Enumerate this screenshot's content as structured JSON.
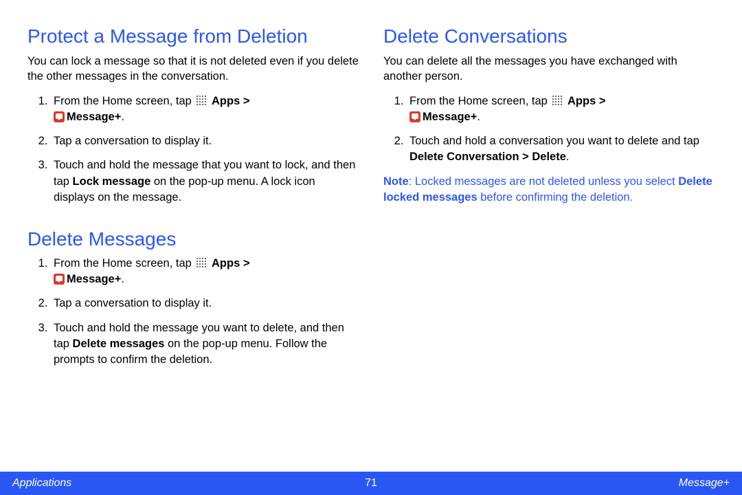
{
  "left": {
    "section1": {
      "title": "Protect a Message from Deletion",
      "intro": "You can lock a message so that it is not deleted even if you delete the other messages in the conversation.",
      "steps": {
        "s1_a": "From the Home screen, tap ",
        "s1_apps": "Apps > ",
        "s1_msg": "Message+",
        "s1_end": ".",
        "s2": "Tap a conversation to display it.",
        "s3_a": "Touch and hold the message that you want to lock, and then tap ",
        "s3_b": "Lock message",
        "s3_c": " on the pop-up menu. A lock icon displays on the message."
      }
    },
    "section2": {
      "title": "Delete Messages",
      "steps": {
        "s1_a": "From the Home screen, tap ",
        "s1_apps": "Apps > ",
        "s1_msg": "Message+",
        "s1_end": ".",
        "s2": "Tap a conversation to display it.",
        "s3_a": "Touch and hold the message you want to delete, and then tap ",
        "s3_b": "Delete messages",
        "s3_c": " on the pop-up menu. Follow the prompts to confirm the deletion."
      }
    }
  },
  "right": {
    "section1": {
      "title": "Delete Conversations",
      "intro": "You can delete all the messages you have exchanged with another person.",
      "steps": {
        "s1_a": "From the Home screen, tap ",
        "s1_apps": "Apps > ",
        "s1_msg": "Message+",
        "s1_end": ".",
        "s2_a": "Touch and hold a conversation you want to delete and tap ",
        "s2_b": "Delete Conversation > Delete",
        "s2_c": "."
      },
      "note": {
        "label": "Note",
        "a": ": Locked messages are not deleted unless you select ",
        "b": "Delete locked messages",
        "c": " before confirming the deletion."
      }
    }
  },
  "footer": {
    "left": "Applications",
    "center": "71",
    "right": "Message+"
  }
}
